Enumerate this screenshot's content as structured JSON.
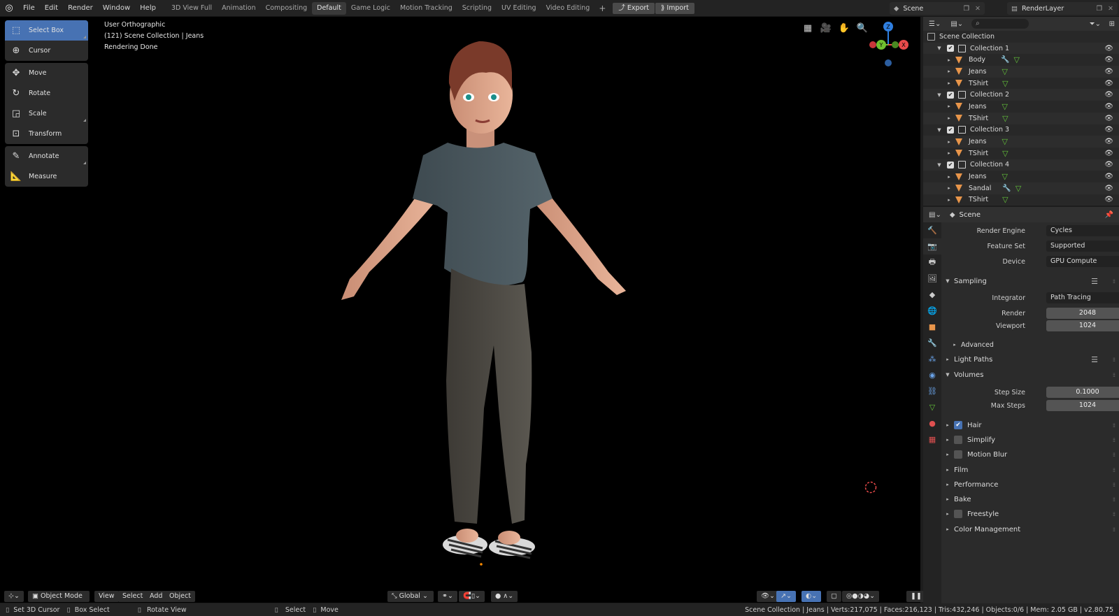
{
  "menu": [
    "File",
    "Edit",
    "Render",
    "Window",
    "Help"
  ],
  "workspaces": [
    "3D View Full",
    "Animation",
    "Compositing",
    "Default",
    "Game Logic",
    "Motion Tracking",
    "Scripting",
    "UV Editing",
    "Video Editing"
  ],
  "active_workspace": "Default",
  "header_buttons": {
    "export": "Export",
    "import": "Import"
  },
  "scene_name": "Scene",
  "render_layer": "RenderLayer",
  "tools": {
    "group1": [
      "Select Box",
      "Cursor"
    ],
    "group2": [
      "Move",
      "Rotate",
      "Scale",
      "Transform"
    ],
    "group3": [
      "Annotate",
      "Measure"
    ]
  },
  "viewport": {
    "view_name": "User Orthographic",
    "collection_info": "(121) Scene Collection | Jeans",
    "render_status": "Rendering Done",
    "gizmo": {
      "z": "Z",
      "y": "Y",
      "x": "X"
    }
  },
  "viewport_header": {
    "mode": "Object Mode",
    "menus": [
      "View",
      "Select",
      "Add",
      "Object"
    ],
    "orientation": "Global"
  },
  "statusbar": {
    "left": [
      "Set 3D Cursor",
      "Box Select",
      "Rotate View",
      "Select",
      "Move"
    ],
    "right": "Scene Collection | Jeans | Verts:217,075 | Faces:216,123 | Tris:432,246 | Objects:0/6 | Mem: 2.05 GB | v2.80.75"
  },
  "outliner": {
    "root": "Scene Collection",
    "collections": [
      {
        "name": "Collection 1",
        "objects": [
          {
            "name": "Body",
            "modifier": true
          },
          {
            "name": "Jeans",
            "modifier": false
          },
          {
            "name": "TShirt",
            "modifier": false
          }
        ]
      },
      {
        "name": "Collection 2",
        "objects": [
          {
            "name": "Jeans",
            "modifier": false
          },
          {
            "name": "TShirt",
            "modifier": false
          }
        ]
      },
      {
        "name": "Collection 3",
        "objects": [
          {
            "name": "Jeans",
            "modifier": false
          },
          {
            "name": "TShirt",
            "modifier": false
          }
        ]
      },
      {
        "name": "Collection 4",
        "objects": [
          {
            "name": "Jeans",
            "modifier": false
          },
          {
            "name": "Sandal",
            "modifier": true
          },
          {
            "name": "TShirt",
            "modifier": false
          }
        ]
      }
    ]
  },
  "properties": {
    "context": "Scene",
    "render_engine": {
      "label": "Render Engine",
      "value": "Cycles"
    },
    "feature_set": {
      "label": "Feature Set",
      "value": "Supported"
    },
    "device": {
      "label": "Device",
      "value": "GPU Compute"
    },
    "sampling": {
      "title": "Sampling",
      "integrator_label": "Integrator",
      "integrator": "Path Tracing",
      "render_label": "Render",
      "render": "2048",
      "viewport_label": "Viewport",
      "viewport": "1024",
      "advanced": "Advanced"
    },
    "light_paths": "Light Paths",
    "volumes": {
      "title": "Volumes",
      "step_size_label": "Step Size",
      "step_size": "0.1000",
      "max_steps_label": "Max Steps",
      "max_steps": "1024"
    },
    "sections": [
      "Hair",
      "Simplify",
      "Motion Blur",
      "Film",
      "Performance",
      "Bake",
      "Freestyle",
      "Color Management"
    ]
  },
  "colors": {
    "accent": "#4772b3",
    "viewport_bg": "#000000",
    "panel_bg": "#2b2b2b"
  }
}
